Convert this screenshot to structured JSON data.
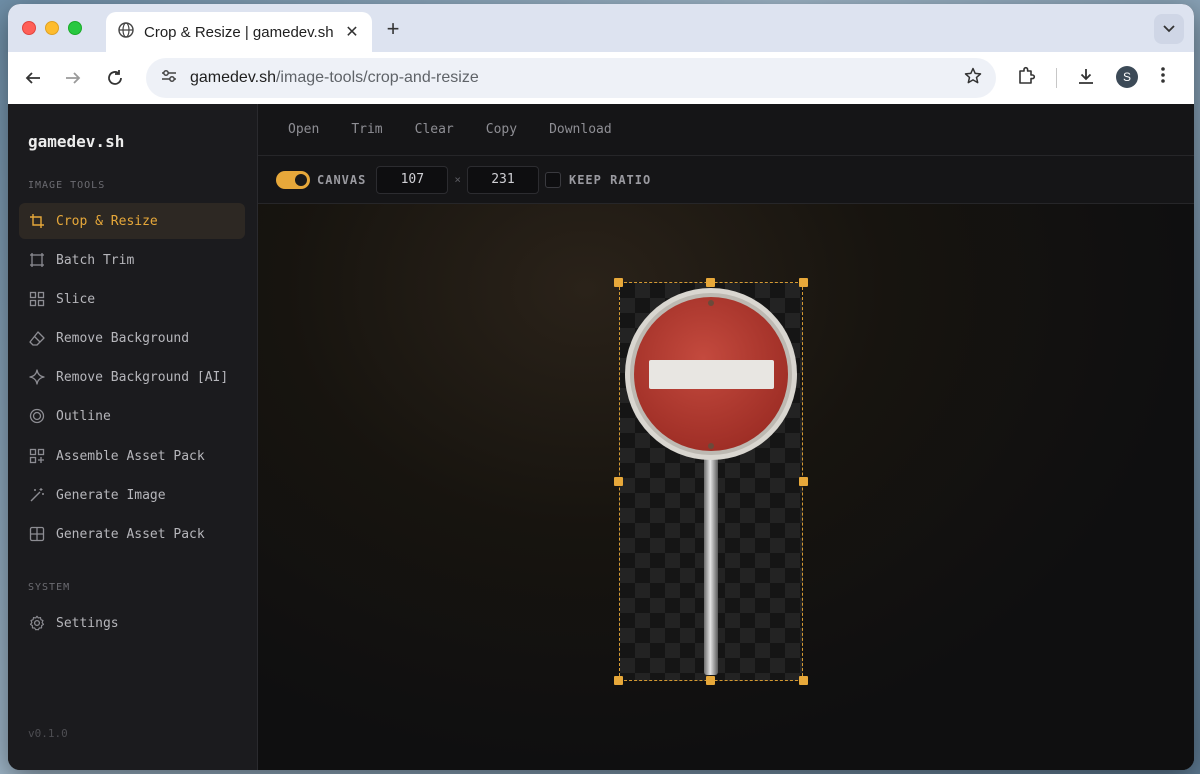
{
  "browser": {
    "tab_title": "Crop & Resize | gamedev.sh",
    "url_host": "gamedev.sh",
    "url_path": "/image-tools/crop-and-resize",
    "profile_initial": "S"
  },
  "sidebar": {
    "brand": "gamedev.sh",
    "section_tools": "IMAGE TOOLS",
    "items": [
      {
        "label": "Crop & Resize",
        "icon": "crop-icon",
        "active": true
      },
      {
        "label": "Batch Trim",
        "icon": "trim-icon"
      },
      {
        "label": "Slice",
        "icon": "grid-icon"
      },
      {
        "label": "Remove Background",
        "icon": "eraser-icon"
      },
      {
        "label": "Remove Background [AI]",
        "icon": "sparkle-icon"
      },
      {
        "label": "Outline",
        "icon": "outline-icon"
      },
      {
        "label": "Assemble Asset Pack",
        "icon": "assemble-icon"
      },
      {
        "label": "Generate Image",
        "icon": "magic-wand-icon"
      },
      {
        "label": "Generate Asset Pack",
        "icon": "layout-icon"
      }
    ],
    "section_system": "SYSTEM",
    "settings_label": "Settings",
    "version": "v0.1.0"
  },
  "menu": {
    "open": "Open",
    "trim": "Trim",
    "clear": "Clear",
    "copy": "Copy",
    "download": "Download"
  },
  "options": {
    "canvas_label": "CANVAS",
    "canvas_enabled": true,
    "width": "107",
    "times": "×",
    "height": "231",
    "keep_ratio_label": "KEEP RATIO",
    "keep_ratio": false
  },
  "colors": {
    "accent": "#e7a83a",
    "sign_red": "#b8362c"
  }
}
